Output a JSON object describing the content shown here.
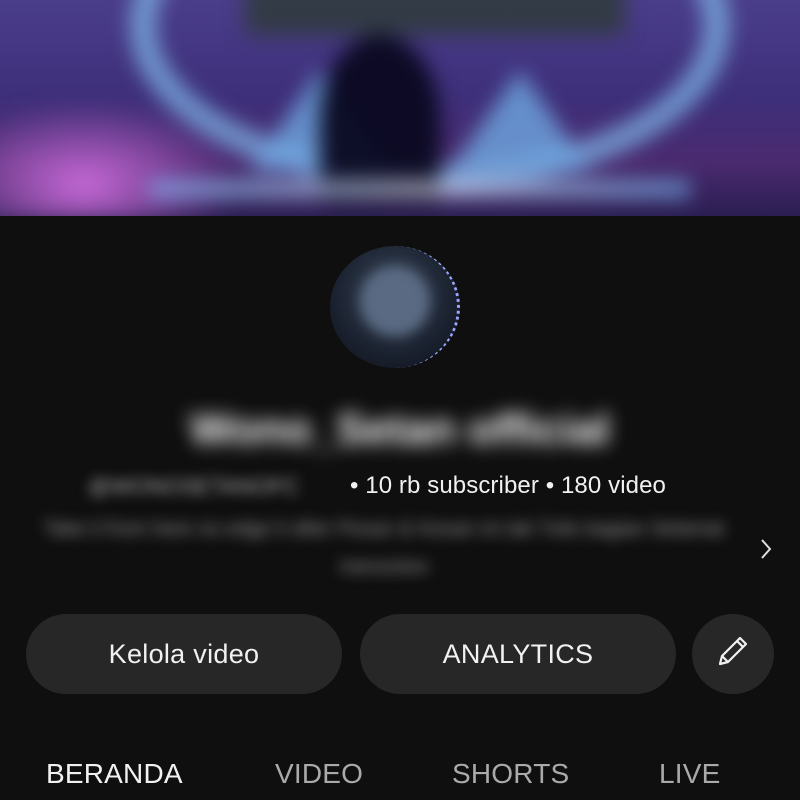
{
  "channel": {
    "name": "Wono_Setan official",
    "handle": "@WONOSETANOFC",
    "stats": "• 10 rb subscriber • 180 video",
    "description": "Take it from here no edge it after Pesan & Kesan ini tak Tulis bagian Selamat menonton"
  },
  "actions": {
    "manage_videos_label": "Kelola video",
    "analytics_label": "ANALYTICS",
    "edit_icon": "pencil-icon"
  },
  "tabs": [
    {
      "label": "BERANDA",
      "active": true
    },
    {
      "label": "VIDEO",
      "active": false
    },
    {
      "label": "SHORTS",
      "active": false
    },
    {
      "label": "LIVE",
      "active": false
    }
  ],
  "colors": {
    "background": "#0f0f0f",
    "button_bg": "#272727",
    "text_primary": "#f1f1f1",
    "text_secondary": "#aaaaaa"
  }
}
